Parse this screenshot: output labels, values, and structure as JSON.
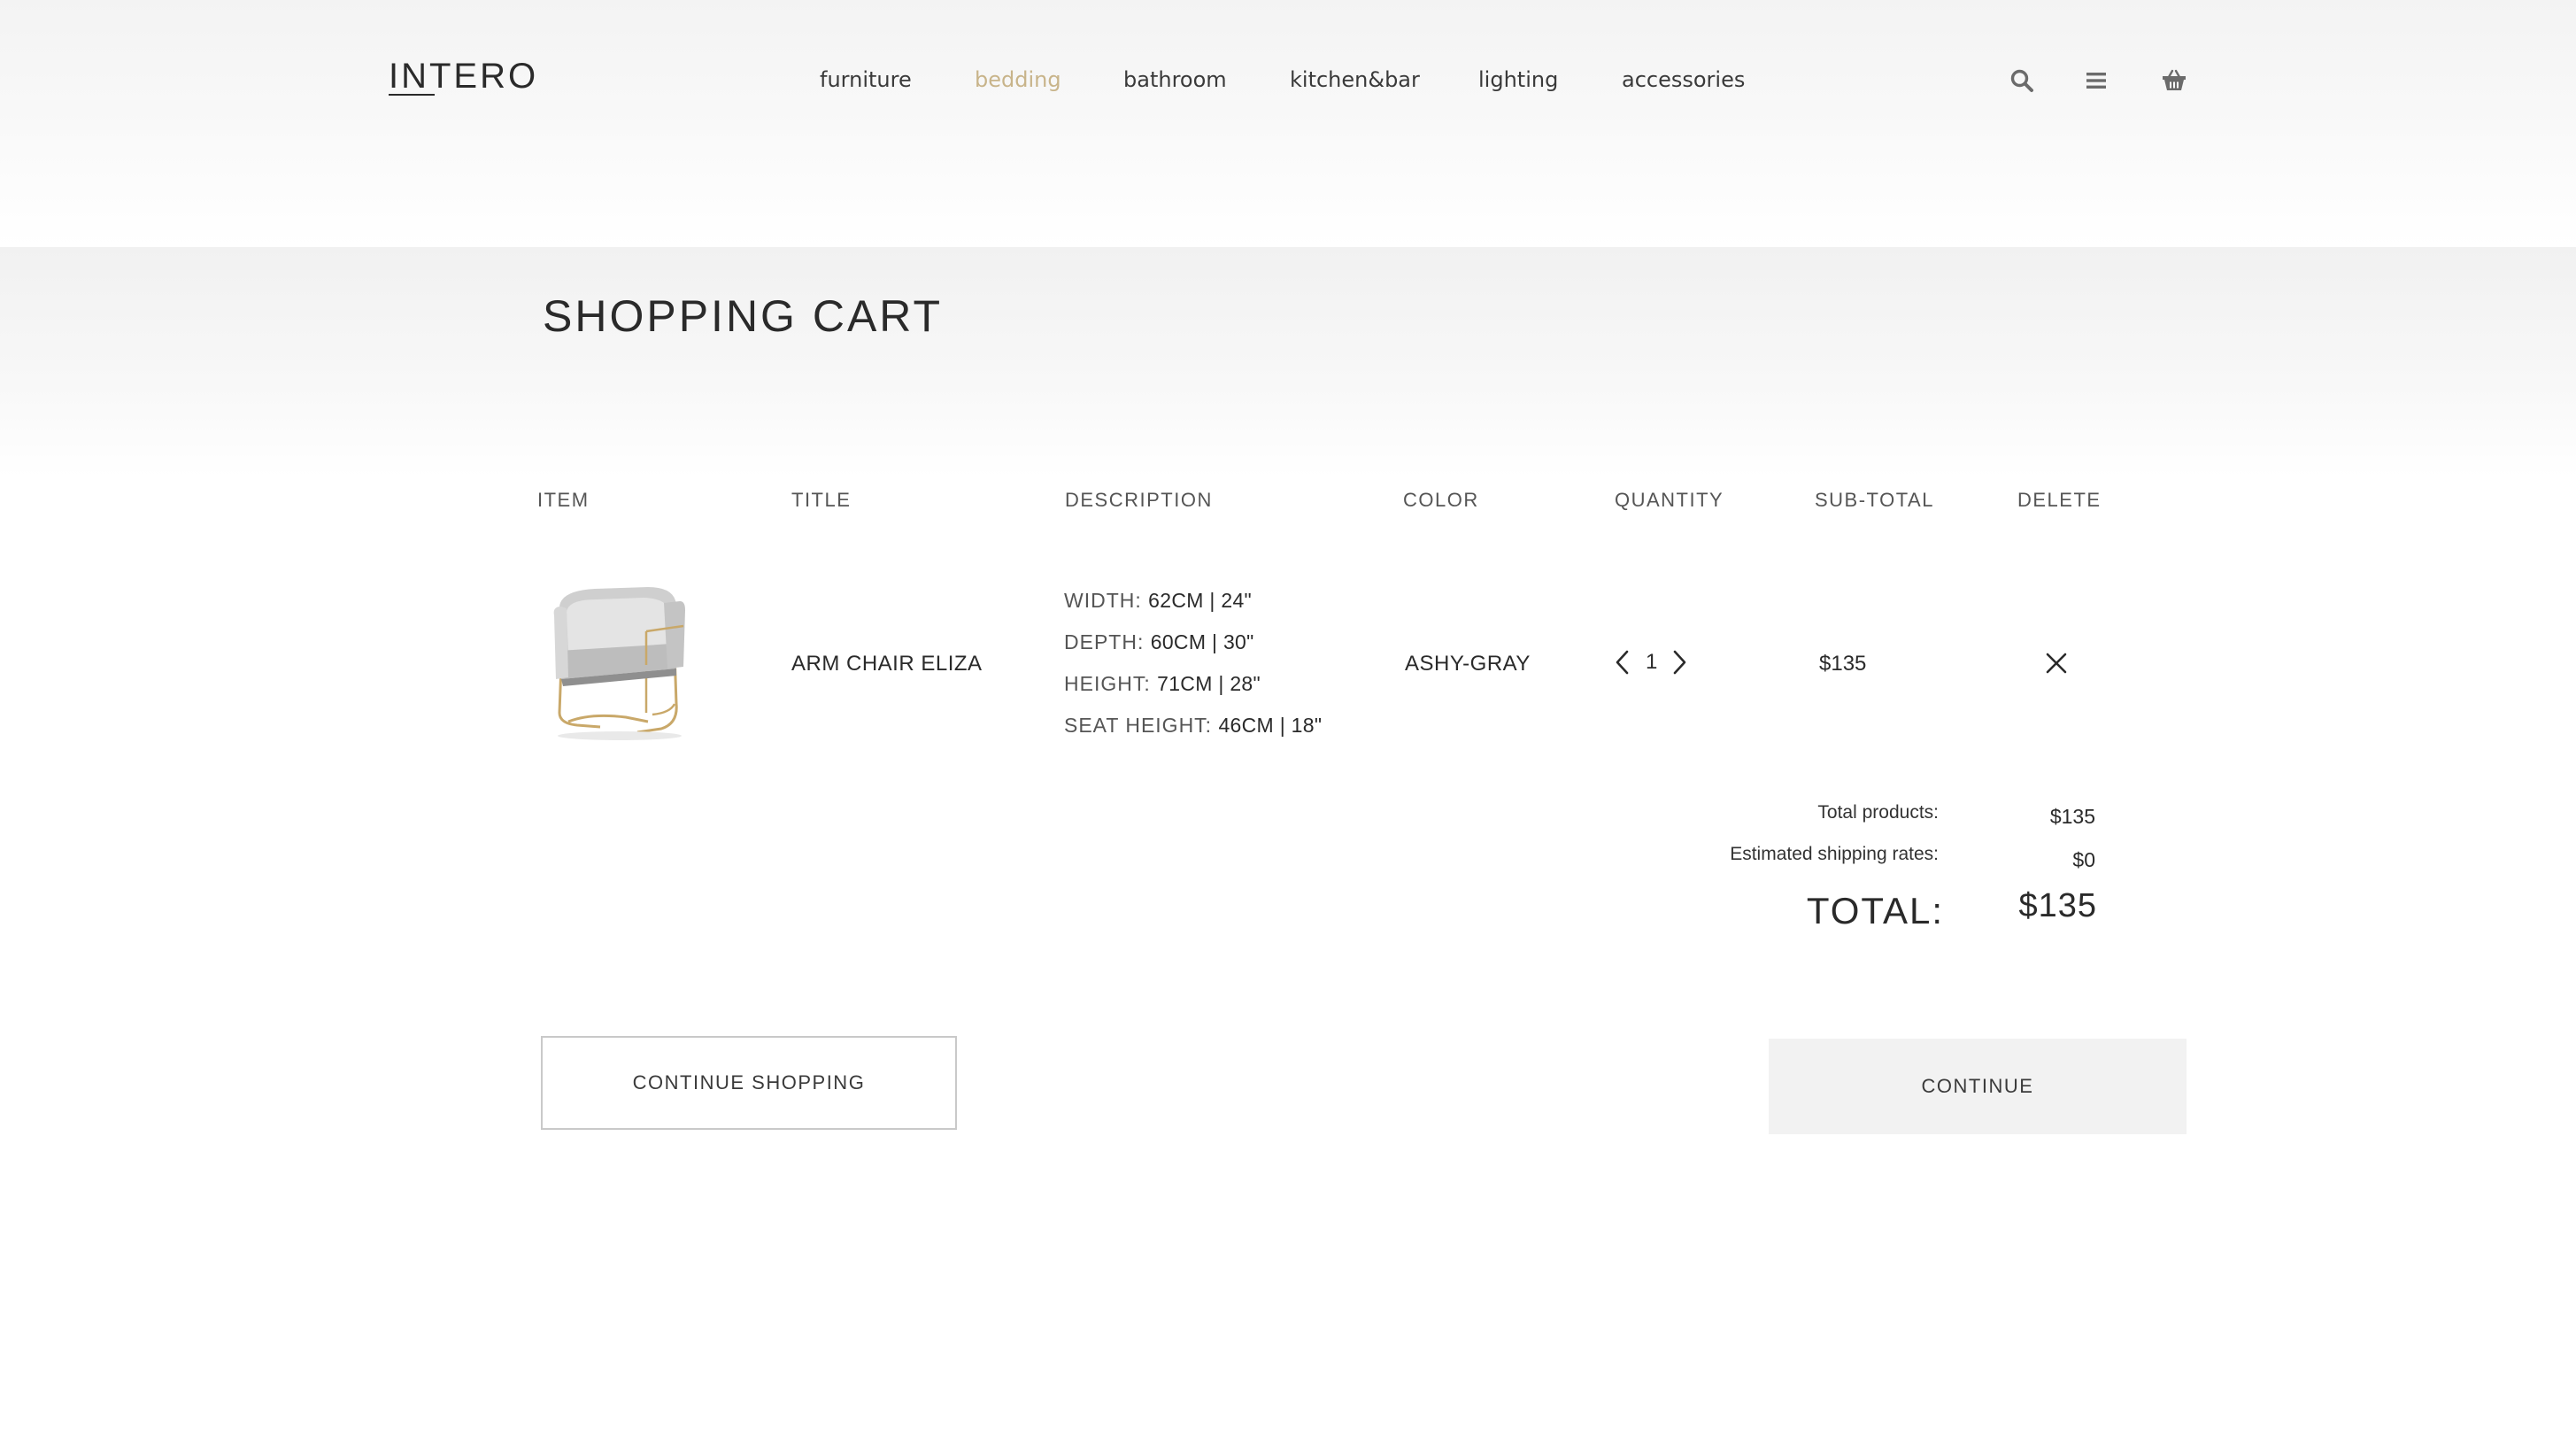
{
  "brand": {
    "logo": "INTERO"
  },
  "nav": {
    "items": [
      {
        "label": "furniture",
        "active": false
      },
      {
        "label": "bedding",
        "active": true
      },
      {
        "label": "bathroom",
        "active": false
      },
      {
        "label": "kitchen&bar",
        "active": false
      },
      {
        "label": "lighting",
        "active": false
      },
      {
        "label": "accessories",
        "active": false
      }
    ],
    "icons": [
      "search-icon",
      "menu-icon",
      "basket-icon"
    ]
  },
  "cart": {
    "title": "SHOPPING CART",
    "columns": [
      "ITEM",
      "TITLE",
      "DESCRIPTION",
      "COLOR",
      "QUANTITY",
      "SUB-TOTAL",
      "DELETE"
    ],
    "items": [
      {
        "title": "ARM CHAIR ELIZA",
        "description": [
          {
            "label": "WIDTH:",
            "value": "62CM | 24\""
          },
          {
            "label": "DEPTH:",
            "value": "60CM | 30\""
          },
          {
            "label": "HEIGHT:",
            "value": "71CM | 28\""
          },
          {
            "label": "SEAT HEIGHT:",
            "value": "46CM | 18\""
          }
        ],
        "color": "ASHY-GRAY",
        "quantity": "1",
        "subtotal": "$135"
      }
    ]
  },
  "summary": {
    "total_products_label": "Total products:",
    "total_products_value": "$135",
    "shipping_label": "Estimated shipping rates:",
    "shipping_value": "$0",
    "total_label": "TOTAL:",
    "total_value": "$135"
  },
  "actions": {
    "continue_shopping": "CONTINUE SHOPPING",
    "continue": "CONTINUE"
  },
  "colors": {
    "accent": "#c8b48a",
    "text": "#2a2a2a",
    "button_bg": "#f2f2f2"
  }
}
